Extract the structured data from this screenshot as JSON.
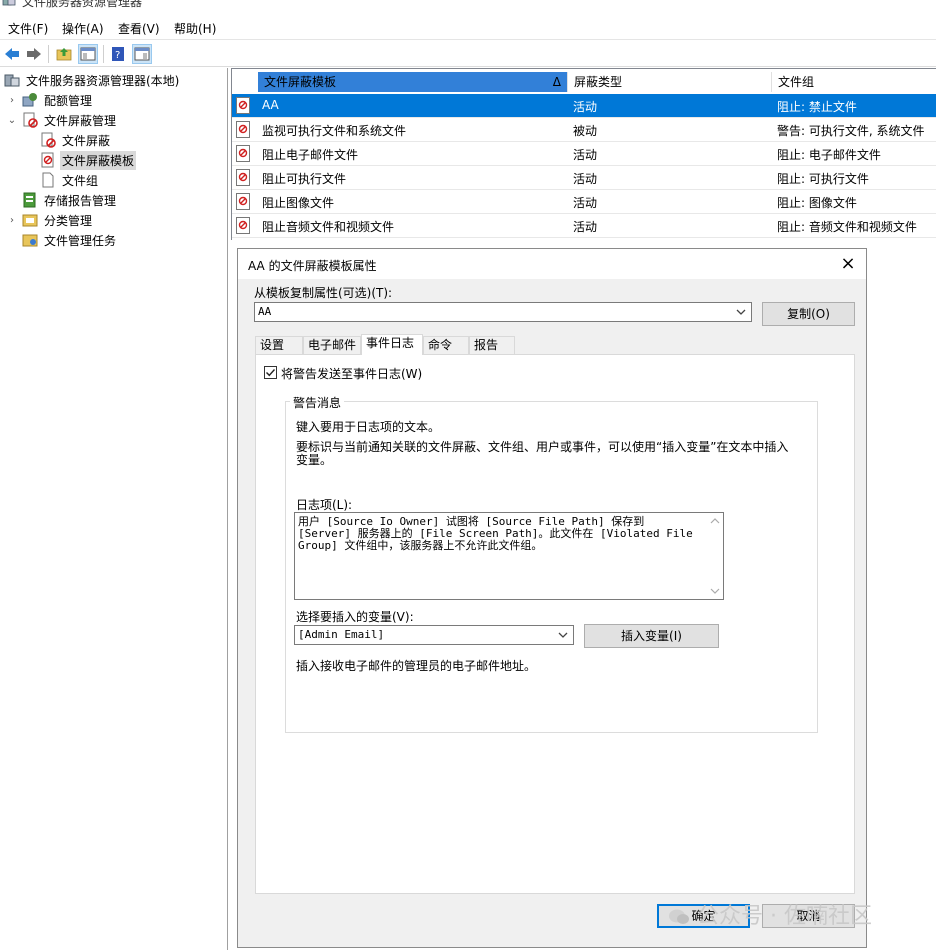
{
  "window": {
    "title": "文件服务器资源管理器"
  },
  "menu": [
    "文件(F)",
    "操作(A)",
    "查看(V)",
    "帮助(H)"
  ],
  "tree": {
    "items": [
      {
        "label": "文件服务器资源管理器(本地)"
      },
      {
        "label": "配额管理"
      },
      {
        "label": "文件屏蔽管理"
      },
      {
        "label": "文件屏蔽"
      },
      {
        "label": "文件屏蔽模板"
      },
      {
        "label": "文件组"
      },
      {
        "label": "存储报告管理"
      },
      {
        "label": "分类管理"
      },
      {
        "label": "文件管理任务"
      }
    ]
  },
  "list": {
    "columns": [
      "文件屏蔽模板",
      "屏蔽类型",
      "文件组"
    ],
    "sort_indicator": "Δ",
    "rows": [
      {
        "name": "AA",
        "type": "活动",
        "group": "阻止: 禁止文件"
      },
      {
        "name": "监视可执行文件和系统文件",
        "type": "被动",
        "group": "警告: 可执行文件, 系统文件"
      },
      {
        "name": "阻止电子邮件文件",
        "type": "活动",
        "group": "阻止: 电子邮件文件"
      },
      {
        "name": "阻止可执行文件",
        "type": "活动",
        "group": "阻止: 可执行文件"
      },
      {
        "name": "阻止图像文件",
        "type": "活动",
        "group": "阻止: 图像文件"
      },
      {
        "name": "阻止音频文件和视频文件",
        "type": "活动",
        "group": "阻止: 音频文件和视频文件"
      }
    ]
  },
  "dialog": {
    "title": "AA 的文件屏蔽模板属性",
    "copy_from_label": "从模板复制属性(可选)(T):",
    "copy_from_value": "AA",
    "copy_button": "复制(O)",
    "tabs": [
      "设置",
      "电子邮件",
      "事件日志",
      "命令",
      "报告"
    ],
    "active_tab": "事件日志",
    "send_warning_label": "将警告发送至事件日志(W)",
    "send_warning_checked": true,
    "group_title": "警告消息",
    "intro_text": "键入要用于日志项的文本。",
    "help_text_line1": "要标识与当前通知关联的文件屏蔽、文件组、用户或事件，可以使用“插入变量”在文本中插入",
    "help_text_line2": "变量。",
    "log_entry_label": "日志项(L):",
    "log_entry_text": "用户 [Source Io Owner] 试图将 [Source File Path] 保存到 [Server] 服务器上的 [File Screen Path]。此文件在 [Violated File Group] 文件组中，该服务器上不允许此文件组。",
    "variable_label": "选择要插入的变量(V):",
    "variable_value": "[Admin Email]",
    "insert_button": "插入变量(I)",
    "variable_desc": "插入接收电子邮件的管理员的电子邮件地址。",
    "ok_button": "确定",
    "cancel_button": "取消"
  },
  "watermark": "公众号 · 佐喃社区",
  "colors": {
    "selection": "#0078d7",
    "sorted_header": "#3280d8",
    "dialog_bg": "#f0f0f0"
  }
}
